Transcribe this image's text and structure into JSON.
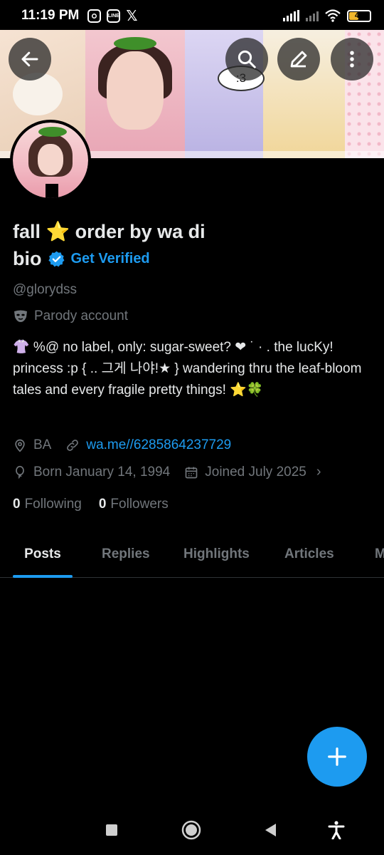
{
  "status_bar": {
    "time": "11:19 PM",
    "apps": [
      "instagram-icon",
      "line-icon",
      "x-icon"
    ],
    "line_label": "LINE",
    "x_label": "𝕏",
    "battery": "43"
  },
  "banner": {
    "bubble_text": ":3"
  },
  "profile": {
    "name_line1": "fall ⭐ order by wa di",
    "name_line2": "bio",
    "get_verified": "Get Verified",
    "handle": "@glorydss",
    "parody": "Parody account",
    "bio": "👚 %@  no label, only: sugar-sweet? ❤ ˙ · .  the lucKy! princess :p { .. 그게 나야!★ } wandering thru the leaf-bloom tales and every fragile pretty things! ⭐🍀",
    "location": "BA",
    "website": "wa.me//6285864237729",
    "birthday": "Born January 14, 1994",
    "joined": "Joined July 2025",
    "following_count": "0",
    "following_label": "Following",
    "followers_count": "0",
    "followers_label": "Followers"
  },
  "tabs": [
    {
      "label": "Posts",
      "active": true
    },
    {
      "label": "Replies"
    },
    {
      "label": "Highlights"
    },
    {
      "label": "Articles"
    },
    {
      "label": "M"
    }
  ],
  "colors": {
    "accent": "#1d9bf0",
    "muted": "#71767b",
    "text": "#e7e9ea",
    "battery": "#f0b62c"
  }
}
